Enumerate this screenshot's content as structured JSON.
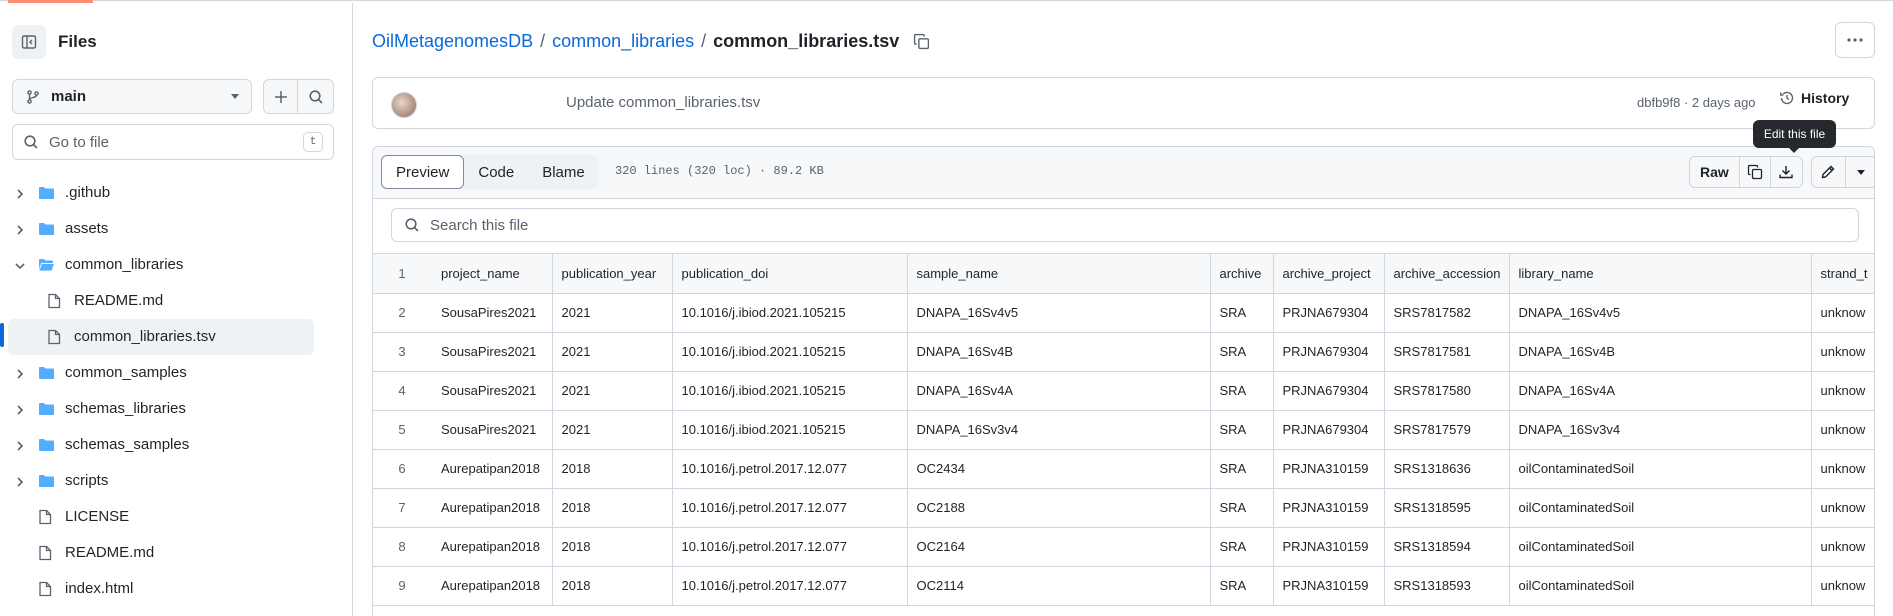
{
  "sidebar": {
    "title": "Files",
    "branch": "main",
    "goto_placeholder": "Go to file",
    "goto_shortcut": "t",
    "tree": [
      {
        "label": ".github",
        "type": "folder",
        "expanded": false
      },
      {
        "label": "assets",
        "type": "folder",
        "expanded": false
      },
      {
        "label": "common_libraries",
        "type": "folder",
        "expanded": true
      },
      {
        "label": "README.md",
        "type": "file",
        "child": true
      },
      {
        "label": "common_libraries.tsv",
        "type": "file",
        "child": true,
        "selected": true
      },
      {
        "label": "common_samples",
        "type": "folder",
        "expanded": false
      },
      {
        "label": "schemas_libraries",
        "type": "folder",
        "expanded": false
      },
      {
        "label": "schemas_samples",
        "type": "folder",
        "expanded": false
      },
      {
        "label": "scripts",
        "type": "folder",
        "expanded": false
      },
      {
        "label": "LICENSE",
        "type": "file"
      },
      {
        "label": "README.md",
        "type": "file"
      },
      {
        "label": "index.html",
        "type": "file"
      }
    ]
  },
  "breadcrumb": {
    "repo": "OilMetagenomesDB",
    "sep1": "/",
    "folder": "common_libraries",
    "sep2": "/",
    "file": "common_libraries.tsv"
  },
  "commit": {
    "message": "Update common_libraries.tsv",
    "meta": "dbfb9f8 · 2 days ago",
    "history_label": "History"
  },
  "tooltip": "Edit this file",
  "file_header": {
    "tabs": [
      "Preview",
      "Code",
      "Blame"
    ],
    "active_tab": "Preview",
    "info": "320 lines (320 loc) · 89.2 KB",
    "raw_label": "Raw"
  },
  "search_placeholder": "Search this file",
  "table": {
    "columns": [
      "project_name",
      "publication_year",
      "publication_doi",
      "sample_name",
      "archive",
      "archive_project",
      "archive_accession",
      "library_name",
      "strand_t"
    ],
    "rows": [
      [
        "SousaPires2021",
        "2021",
        "10.1016/j.ibiod.2021.105215",
        "DNAPA_16Sv4v5",
        "SRA",
        "PRJNA679304",
        "SRS7817582",
        "DNAPA_16Sv4v5",
        "unknow"
      ],
      [
        "SousaPires2021",
        "2021",
        "10.1016/j.ibiod.2021.105215",
        "DNAPA_16Sv4B",
        "SRA",
        "PRJNA679304",
        "SRS7817581",
        "DNAPA_16Sv4B",
        "unknow"
      ],
      [
        "SousaPires2021",
        "2021",
        "10.1016/j.ibiod.2021.105215",
        "DNAPA_16Sv4A",
        "SRA",
        "PRJNA679304",
        "SRS7817580",
        "DNAPA_16Sv4A",
        "unknow"
      ],
      [
        "SousaPires2021",
        "2021",
        "10.1016/j.ibiod.2021.105215",
        "DNAPA_16Sv3v4",
        "SRA",
        "PRJNA679304",
        "SRS7817579",
        "DNAPA_16Sv3v4",
        "unknow"
      ],
      [
        "Aurepatipan2018",
        "2018",
        "10.1016/j.petrol.2017.12.077",
        "OC2434",
        "SRA",
        "PRJNA310159",
        "SRS1318636",
        "oilContaminatedSoil",
        "unknow"
      ],
      [
        "Aurepatipan2018",
        "2018",
        "10.1016/j.petrol.2017.12.077",
        "OC2188",
        "SRA",
        "PRJNA310159",
        "SRS1318595",
        "oilContaminatedSoil",
        "unknow"
      ],
      [
        "Aurepatipan2018",
        "2018",
        "10.1016/j.petrol.2017.12.077",
        "OC2164",
        "SRA",
        "PRJNA310159",
        "SRS1318594",
        "oilContaminatedSoil",
        "unknow"
      ],
      [
        "Aurepatipan2018",
        "2018",
        "10.1016/j.petrol.2017.12.077",
        "OC2114",
        "SRA",
        "PRJNA310159",
        "SRS1318593",
        "oilContaminatedSoil",
        "unknow"
      ]
    ]
  }
}
